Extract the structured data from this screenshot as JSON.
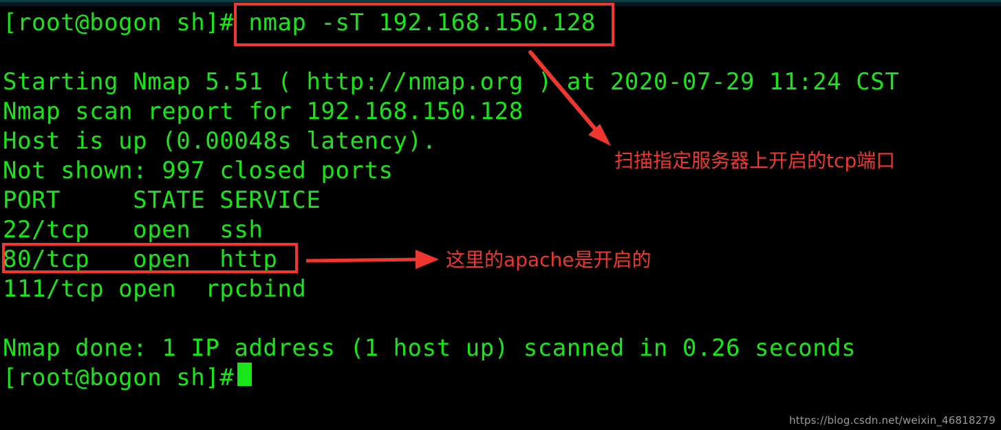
{
  "window": {
    "title": "nmap TCP connect scan terminal output",
    "background_color": "#000000",
    "terminal_text_color": "#19e619",
    "annotation_color": "#f0372f",
    "top_strip_color": "#0e3d43"
  },
  "terminal": {
    "lines": [
      {
        "id": "prompt-command",
        "text": "[root@bogon sh]# nmap -sT 192.168.150.128"
      },
      {
        "id": "starting",
        "text": "Starting Nmap 5.51 ( http://nmap.org ) at 2020-07-29 11:24 CST"
      },
      {
        "id": "scan-report",
        "text": "Nmap scan report for 192.168.150.128"
      },
      {
        "id": "host-up",
        "text": "Host is up (0.00048s latency)."
      },
      {
        "id": "not-shown",
        "text": "Not shown: 997 closed ports"
      },
      {
        "id": "table-header",
        "text": "PORT     STATE SERVICE"
      },
      {
        "id": "port-22",
        "text": "22/tcp   open  ssh"
      },
      {
        "id": "port-80",
        "text": "80/tcp   open  http"
      },
      {
        "id": "port-111",
        "text": "111/tcp open  rpcbind"
      },
      {
        "id": "nmap-done",
        "text": "Nmap done: 1 IP address (1 host up) scanned in 0.26 seconds"
      },
      {
        "id": "final-prompt",
        "text": "[root@bogon sh]#"
      }
    ],
    "prompt": "[root@bogon sh]#",
    "command": "nmap -sT 192.168.150.128",
    "cursor": "block-cursor",
    "scan_results": {
      "columns": [
        "PORT",
        "STATE",
        "SERVICE"
      ],
      "rows": [
        {
          "port": "22/tcp",
          "state": "open",
          "service": "ssh"
        },
        {
          "port": "80/tcp",
          "state": "open",
          "service": "http"
        },
        {
          "port": "111/tcp",
          "state": "open",
          "service": "rpcbind"
        }
      ],
      "nmap_version": "5.51",
      "nmap_url": "http://nmap.org",
      "scan_datetime": "2020-07-29 11:24 CST",
      "target_host": "192.168.150.128",
      "latency": "0.00048s",
      "closed_ports_not_shown": "997",
      "hosts_up": "1",
      "elapsed_seconds": "0.26"
    }
  },
  "annotations": [
    {
      "id": "annotation-tcp-scan",
      "text": "扫描指定服务器上开启的tcp端口",
      "points_to": "nmap -sT 192.168.150.128"
    },
    {
      "id": "annotation-apache-open",
      "text": "这里的apache是开启的",
      "points_to": "80/tcp open http"
    }
  ],
  "watermark": {
    "text": "https://blog.csdn.net/weixin_46818279"
  }
}
